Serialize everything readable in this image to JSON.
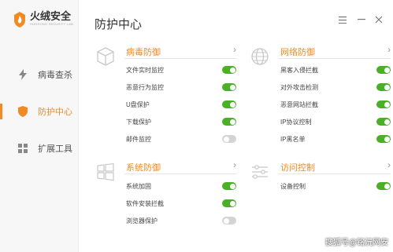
{
  "app": {
    "name": "火绒安全",
    "tagline": "HUORONG SECURITY LAB"
  },
  "sidebar": {
    "items": [
      {
        "label": "病毒查杀",
        "icon": "lightning-icon",
        "active": false
      },
      {
        "label": "防护中心",
        "icon": "shield-icon",
        "active": true
      },
      {
        "label": "扩展工具",
        "icon": "grid-icon",
        "active": false
      }
    ]
  },
  "header": {
    "title": "防护中心",
    "menu_icon": "menu-icon",
    "minimize_icon": "minimize-icon",
    "close_icon": "close-icon"
  },
  "cards": {
    "virus": {
      "title": "病毒防御",
      "icon": "cube-icon",
      "more": "›",
      "items": [
        {
          "label": "文件实时监控",
          "enabled": true
        },
        {
          "label": "恶意行为监控",
          "enabled": true
        },
        {
          "label": "U盘保护",
          "enabled": true
        },
        {
          "label": "下载保护",
          "enabled": true
        },
        {
          "label": "邮件监控",
          "enabled": false
        }
      ]
    },
    "network": {
      "title": "网络防御",
      "icon": "globe-icon",
      "more": "›",
      "items": [
        {
          "label": "黑客入侵拦截",
          "enabled": true
        },
        {
          "label": "对外攻击检测",
          "enabled": true
        },
        {
          "label": "恶意网站拦截",
          "enabled": true
        },
        {
          "label": "IP协议控制",
          "enabled": true
        },
        {
          "label": "IP黑名单",
          "enabled": true
        }
      ]
    },
    "system": {
      "title": "系统防御",
      "icon": "windows-icon",
      "more": "›",
      "items": [
        {
          "label": "系统加固",
          "enabled": true
        },
        {
          "label": "软件安装拦截",
          "enabled": true
        },
        {
          "label": "浏览器保护",
          "enabled": false
        }
      ]
    },
    "access": {
      "title": "访问控制",
      "icon": "sliders-icon",
      "more": "›",
      "items": [
        {
          "label": "设备控制",
          "enabled": true
        }
      ]
    }
  },
  "watermark": "搜狐号@铭沅网安",
  "colors": {
    "accent": "#f08a24",
    "toggle_on": "#4caf28",
    "toggle_off": "#d4d4d4"
  }
}
